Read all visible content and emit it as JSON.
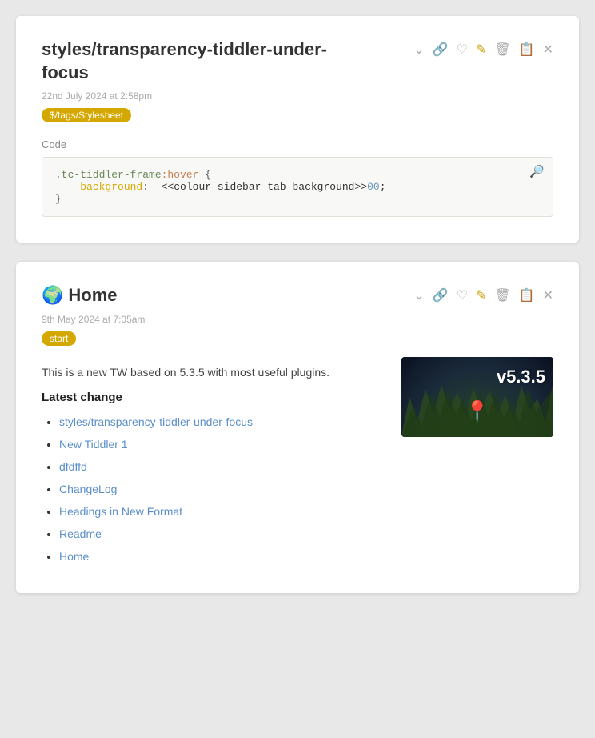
{
  "cards": [
    {
      "id": "card-stylesheet",
      "title": "styles/transparency-tiddler-under-focus",
      "has_globe": false,
      "date": "22nd July 2024 at 2:58pm",
      "tag": "$/tags/Stylesheet",
      "section_label": "Code",
      "code_lines": [
        ".tc-tiddler-frame:hover {",
        "    background:  <<colour sidebar-tab-background>>00;",
        "}"
      ],
      "actions": [
        "chevron-down",
        "link",
        "heart",
        "pencil",
        "trash",
        "copy",
        "close"
      ]
    },
    {
      "id": "card-home",
      "title": "Home",
      "has_globe": true,
      "date": "9th May 2024 at 7:05am",
      "tag": "start",
      "description": "This is a new TW based on 5.3.5 with most useful plugins.",
      "latest_change_heading": "Latest change",
      "links": [
        "styles/transparency-tiddler-under-focus",
        "New Tiddler 1",
        "dfdffd",
        "ChangeLog",
        "Headings in New Format",
        "Readme",
        "Home"
      ],
      "thumbnail_version": "v5.3.5",
      "actions": [
        "chevron-down",
        "link",
        "heart",
        "pencil",
        "trash",
        "copy",
        "close"
      ]
    }
  ]
}
